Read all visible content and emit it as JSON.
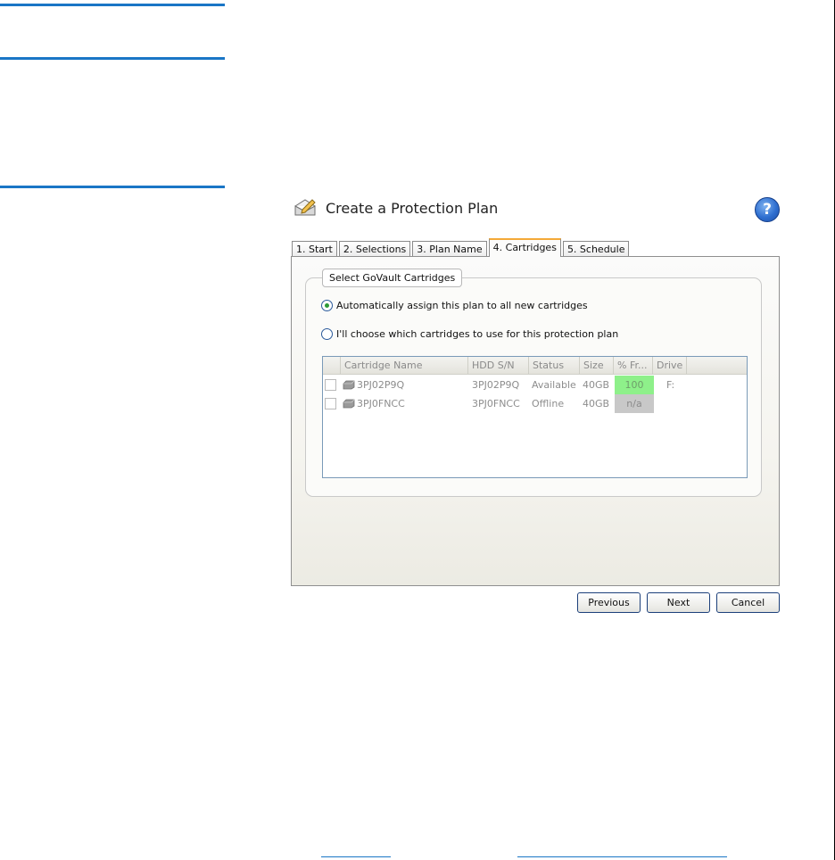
{
  "dialog": {
    "title": "Create a Protection Plan",
    "help_label": "?"
  },
  "tabs": [
    {
      "label": "1. Start",
      "active": false
    },
    {
      "label": "2. Selections",
      "active": false
    },
    {
      "label": "3. Plan Name",
      "active": false
    },
    {
      "label": "4. Cartridges",
      "active": true
    },
    {
      "label": "5. Schedule",
      "active": false
    }
  ],
  "group": {
    "legend": "Select GoVault Cartridges",
    "options": [
      {
        "label": "Automatically assign this plan to all new cartridges",
        "checked": true
      },
      {
        "label": "I'll choose which cartridges to use for this protection plan",
        "checked": false
      }
    ]
  },
  "grid": {
    "columns": [
      "Cartridge Name",
      "HDD S/N",
      "Status",
      "Size",
      "% Fr...",
      "Drive"
    ],
    "rows": [
      {
        "name": "3PJ02P9Q",
        "sn": "3PJ02P9Q",
        "status": "Available",
        "size": "40GB",
        "pct": "100",
        "drive": "F:"
      },
      {
        "name": "3PJ0FNCC",
        "sn": "3PJ0FNCC",
        "status": "Offline",
        "size": "40GB",
        "pct": "n/a",
        "drive": ""
      }
    ]
  },
  "buttons": {
    "previous": "Previous",
    "next": "Next",
    "cancel": "Cancel"
  },
  "colors": {
    "accent_rule": "#1a76c6",
    "active_tab": "#f4a938",
    "pct_available": "#8ef08a",
    "pct_na": "#c8c8c8"
  }
}
